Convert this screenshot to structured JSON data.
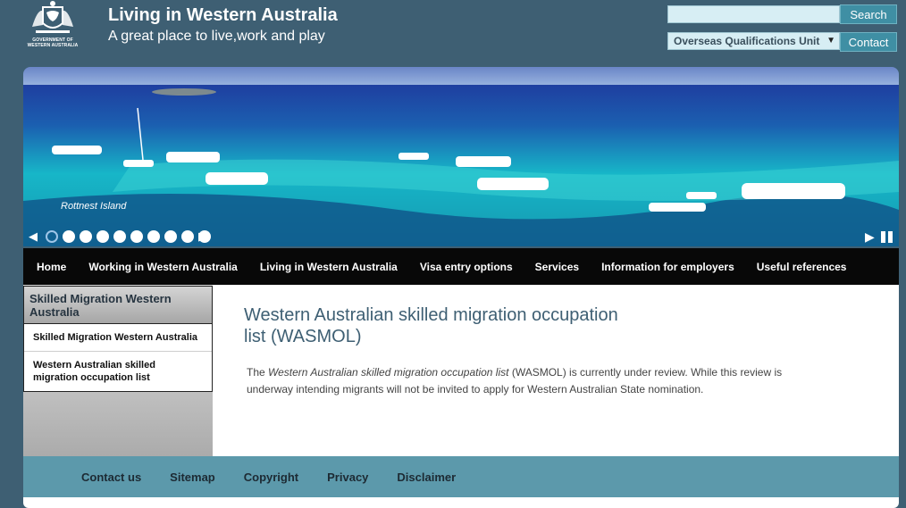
{
  "header": {
    "logo_caption": "GOVERNMENT OF WESTERN AUSTRALIA",
    "title": "Living in Western Australia",
    "tagline": "A great place to live,work and play",
    "search_value": "",
    "search_label": "Search",
    "dept_selected": "Overseas Qualifications Unit",
    "contact_label": "Contact"
  },
  "banner": {
    "caption": "Rottnest Island",
    "slide_count": 10,
    "active_slide": 1
  },
  "nav": {
    "items": [
      "Home",
      "Working in Western Australia",
      "Living in Western Australia",
      "Visa entry options",
      "Services",
      "Information for employers",
      "Useful references"
    ]
  },
  "sidebar": {
    "heading": "Skilled Migration Western Australia",
    "items": [
      "Skilled Migration Western Australia",
      "Western Australian skilled migration occupation list"
    ]
  },
  "content": {
    "title": "Western Australian skilled migration occupation list (WASMOL)",
    "body_prefix": "The ",
    "body_emphasis": "Western Australian skilled migration occupation list",
    "body_suffix": " (WASMOL) is currently under review.  While this review is underway intending migrants will not be invited to apply for Western Australian State nomination."
  },
  "footer": {
    "links": [
      "Contact us",
      "Sitemap",
      "Copyright",
      "Privacy",
      "Disclaimer"
    ]
  },
  "colors": {
    "page_bg": "#3e5f73",
    "accent": "#3f8fa4",
    "footer_bg": "#5c99ab",
    "nav_bg": "#080808"
  }
}
